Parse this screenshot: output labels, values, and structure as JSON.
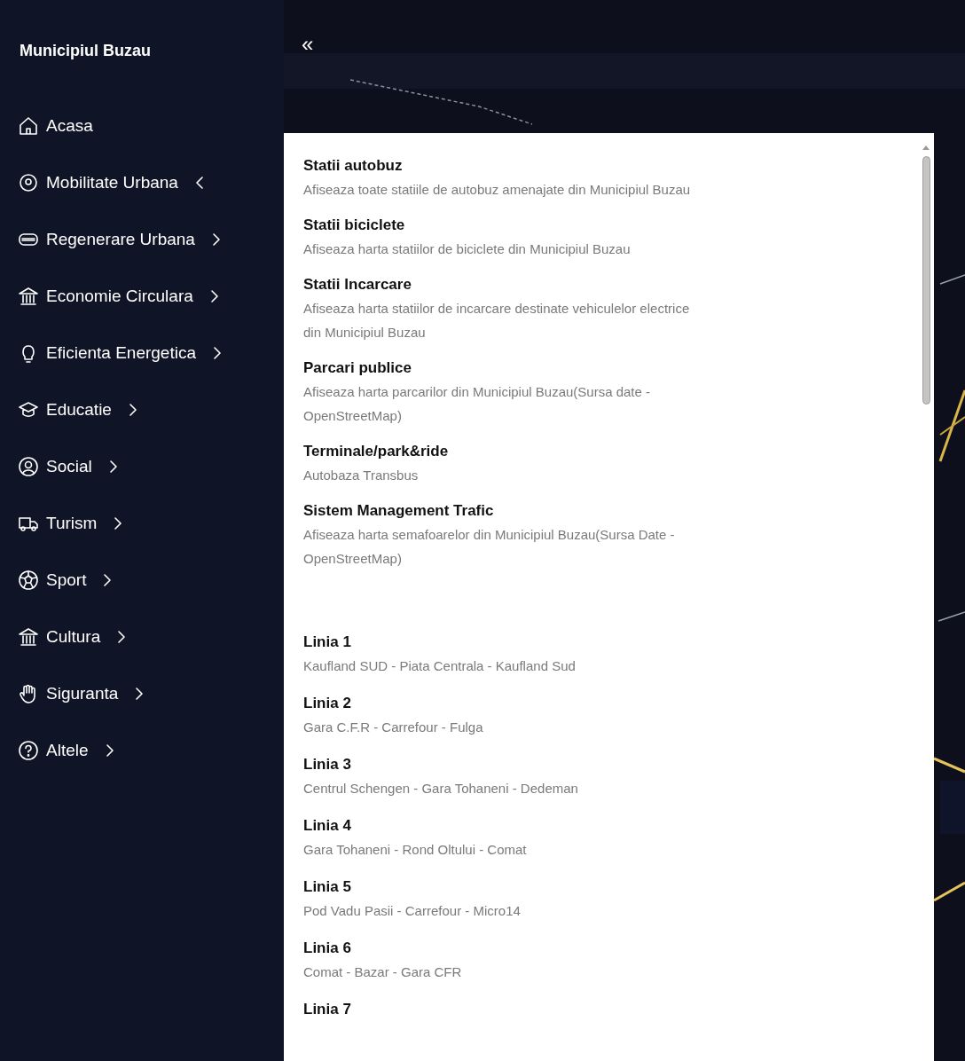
{
  "sidebar": {
    "title": "Municipiul Buzau",
    "collapse": "«",
    "items": [
      {
        "label": "Acasa",
        "kind": "link"
      },
      {
        "label": "Mobilitate Urbana",
        "kind": "menu",
        "expanded": true
      },
      {
        "label": "Regenerare Urbana",
        "kind": "menu",
        "expanded": false
      },
      {
        "label": "Economie Circulara",
        "kind": "menu",
        "expanded": false
      },
      {
        "label": "Eficienta Energetica",
        "kind": "menu",
        "expanded": false
      },
      {
        "label": "Educatie",
        "kind": "menu",
        "expanded": false
      },
      {
        "label": "Social",
        "kind": "menu",
        "expanded": false
      },
      {
        "label": "Turism",
        "kind": "menu",
        "expanded": false
      },
      {
        "label": "Sport",
        "kind": "menu",
        "expanded": false
      },
      {
        "label": "Cultura",
        "kind": "menu",
        "expanded": false
      },
      {
        "label": "Siguranta",
        "kind": "menu",
        "expanded": false
      },
      {
        "label": "Altele",
        "kind": "menu",
        "expanded": false
      }
    ]
  },
  "panel": {
    "layers": [
      {
        "title": "Statii autobuz",
        "description": "Afiseaza toate statiile de autobuz amenajate din Municipiul Buzau"
      },
      {
        "title": "Statii biciclete",
        "description": "Afiseaza harta statiilor de biciclete din Municipiul Buzau"
      },
      {
        "title": "Statii Incarcare",
        "description": "Afiseaza harta statiilor de incarcare destinate vehiculelor electrice din Municipiul Buzau"
      },
      {
        "title": "Parcari publice",
        "description": "Afiseaza harta parcarilor din Municipiul Buzau(Sursa date - OpenStreetMap)"
      },
      {
        "title": "Terminale/park&ride",
        "description": "Autobaza Transbus"
      },
      {
        "title": "Sistem Management Trafic",
        "description": "Afiseaza harta semafoarelor din Municipiul Buzau(Sursa Date - OpenStreetMap)"
      }
    ],
    "lines": [
      {
        "title": "Linia 1",
        "description": "Kaufland SUD - Piata Centrala - Kaufland Sud"
      },
      {
        "title": "Linia 2",
        "description": "Gara C.F.R - Carrefour - Fulga"
      },
      {
        "title": "Linia 3",
        "description": "Centrul Schengen - Gara Tohaneni - Dedeman"
      },
      {
        "title": "Linia 4",
        "description": "Gara Tohaneni - Rond Oltului - Comat"
      },
      {
        "title": "Linia 5",
        "description": "Pod Vadu Pasii - Carrefour - Micro14"
      },
      {
        "title": "Linia 6",
        "description": "Comat - Bazar - Gara CFR"
      },
      {
        "title": "Linia 7"
      }
    ]
  }
}
